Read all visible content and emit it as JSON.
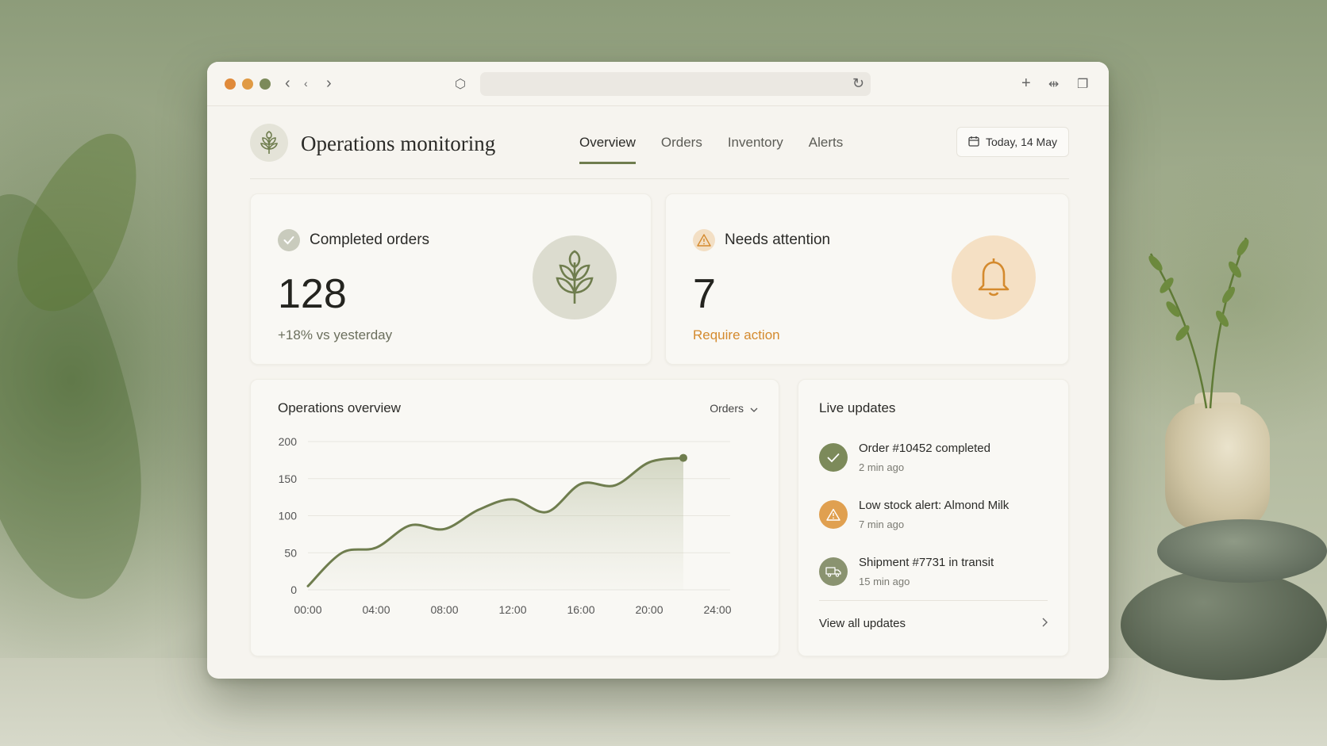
{
  "browser": {
    "url": ""
  },
  "app": {
    "title": "Operations monitoring",
    "tabs": [
      {
        "label": "Overview",
        "active": true
      },
      {
        "label": "Orders",
        "active": false
      },
      {
        "label": "Inventory",
        "active": false
      },
      {
        "label": "Alerts",
        "active": false
      }
    ],
    "date_label": "Today, 14 May"
  },
  "stats": {
    "completed": {
      "label": "Completed orders",
      "value": "128",
      "sub": "+18% vs yesterday"
    },
    "attention": {
      "label": "Needs attention",
      "value": "7",
      "sub": "Require action"
    }
  },
  "overview": {
    "title": "Operations overview",
    "select_value": "Orders"
  },
  "chart_data": {
    "type": "area",
    "x": [
      "00:00",
      "02:00",
      "04:00",
      "06:00",
      "08:00",
      "10:00",
      "12:00",
      "14:00",
      "16:00",
      "18:00",
      "20:00",
      "22:00",
      "24:00"
    ],
    "xticks": [
      "00:00",
      "04:00",
      "08:00",
      "12:00",
      "16:00",
      "20:00",
      "24:00"
    ],
    "values": [
      5,
      52,
      56,
      88,
      82,
      110,
      122,
      105,
      143,
      142,
      175,
      178
    ],
    "y": [
      5,
      50,
      57,
      87,
      82,
      108,
      122,
      105,
      143,
      141,
      172,
      178
    ],
    "yticks": [
      0,
      50,
      100,
      150,
      200
    ],
    "ylim": [
      0,
      200
    ],
    "line_color": "#6f7d4e"
  },
  "live": {
    "title": "Live updates",
    "items": [
      {
        "title": "Order #10452 completed",
        "time": "2 min ago",
        "icon": "check-icon",
        "color": "#7c8a5a"
      },
      {
        "title": "Low stock alert: Almond Milk",
        "time": "7 min ago",
        "icon": "warning-icon",
        "color": "#e0a050"
      },
      {
        "title": "Shipment #7731 in transit",
        "time": "15 min ago",
        "icon": "truck-icon",
        "color": "#8a9370"
      }
    ],
    "view_all": "View all updates"
  }
}
